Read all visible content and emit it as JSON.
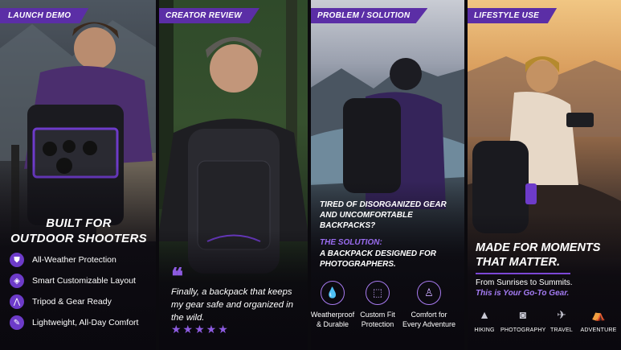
{
  "panels": [
    {
      "tag": "LAUNCH DEMO"
    },
    {
      "tag": "CREATOR REVIEW"
    },
    {
      "tag": "PROBLEM / SOLUTION"
    },
    {
      "tag": "LIFESTYLE USE"
    }
  ],
  "launch": {
    "headline_1": "BUILT FOR",
    "headline_2": "OUTDOOR SHOOTERS",
    "features": [
      {
        "icon": "shield-icon",
        "label": "All-Weather Protection"
      },
      {
        "icon": "cube-icon",
        "label": "Smart Customizable Layout"
      },
      {
        "icon": "tripod-icon",
        "label": "Tripod & Gear Ready"
      },
      {
        "icon": "feather-icon",
        "label": "Lightweight, All-Day Comfort"
      }
    ]
  },
  "review": {
    "quote_mark": "❝",
    "quote": "Finally, a backpack that keeps my gear safe and organized in the wild.",
    "stars": "★★★★★"
  },
  "problem": {
    "problem_text": "TIRED OF DISORGANIZED GEAR AND UNCOMFORTABLE BACKPACKS?",
    "solution_label": "THE SOLUTION:",
    "solution_text": "A BACKPACK DESIGNED FOR PHOTOGRAPHERS.",
    "benefits": [
      {
        "icon": "water-drop-icon",
        "line1": "Weatherproof",
        "line2": "& Durable"
      },
      {
        "icon": "box-icon",
        "line1": "Custom Fit",
        "line2": "Protection"
      },
      {
        "icon": "person-icon",
        "line1": "Comfort for",
        "line2": "Every Adventure"
      }
    ]
  },
  "lifestyle": {
    "headline_1": "MADE FOR MOMENTS",
    "headline_2": "THAT MATTER.",
    "sub_1": "From Sunrises to Summits.",
    "sub_2": "This is Your Go-To Gear.",
    "activities": [
      {
        "icon": "mountain-icon",
        "label": "HIKING"
      },
      {
        "icon": "camera-icon",
        "label": "PHOTOGRAPHY"
      },
      {
        "icon": "plane-icon",
        "label": "TRAVEL"
      },
      {
        "icon": "tent-icon",
        "label": "ADVENTURE"
      }
    ]
  },
  "colors": {
    "accent": "#6d3bc9",
    "accent_light": "#a47bf3",
    "tag_bg": "#5b2ea6"
  }
}
